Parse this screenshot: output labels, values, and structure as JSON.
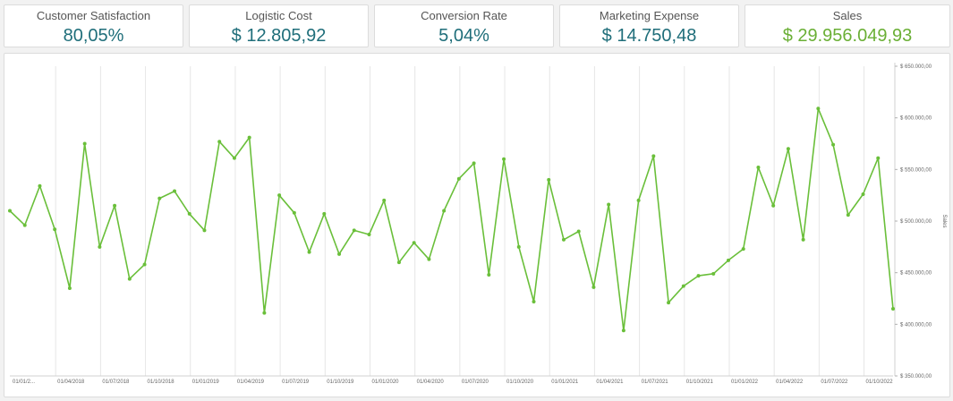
{
  "kpis": [
    {
      "label": "Customer Satisfaction",
      "value": "80,05%"
    },
    {
      "label": "Logistic Cost",
      "value": "$ 12.805,92"
    },
    {
      "label": "Conversion Rate",
      "value": "5,04%"
    },
    {
      "label": "Marketing Expense",
      "value": "$ 14.750,48"
    },
    {
      "label": "Sales",
      "value": "$ 29.956.049,93"
    }
  ],
  "colors": {
    "kpi_value": "#1f6e7a",
    "sales_value": "#6aaf35",
    "line": "#6abf3a",
    "grid": "#e6e6e6"
  },
  "chart_data": {
    "type": "line",
    "title": "",
    "xlabel": "",
    "ylabel": "Sales",
    "ylim": [
      350000,
      650000
    ],
    "y_ticks": [
      350000,
      400000,
      450000,
      500000,
      550000,
      600000,
      650000
    ],
    "y_tick_labels": [
      "$ 350.000,00",
      "$ 400.000,00",
      "$ 450.000,00",
      "$ 500.000,00",
      "$ 550.000,00",
      "$ 600.000,00",
      "$ 650.000,00"
    ],
    "x_tick_labels": [
      "01/01/2...",
      "01/04/2018",
      "01/07/2018",
      "01/10/2018",
      "01/01/2019",
      "01/04/2019",
      "01/07/2019",
      "01/10/2019",
      "01/01/2020",
      "01/04/2020",
      "01/07/2020",
      "01/10/2020",
      "01/01/2021",
      "01/04/2021",
      "01/07/2021",
      "01/10/2021",
      "01/01/2022",
      "01/04/2022",
      "01/07/2022",
      "01/10/2022"
    ],
    "grid": true,
    "series": [
      {
        "name": "Sales",
        "values": [
          510000,
          496000,
          534000,
          492000,
          435000,
          575000,
          475000,
          515000,
          444000,
          458000,
          522000,
          529000,
          507000,
          491000,
          577000,
          561000,
          581000,
          411000,
          525000,
          508000,
          470000,
          507000,
          468000,
          491000,
          487000,
          520000,
          460000,
          479000,
          463000,
          510000,
          541000,
          556000,
          448000,
          560000,
          475000,
          422000,
          540000,
          482000,
          490000,
          436000,
          516000,
          394000,
          520000,
          563000,
          421000,
          437000,
          447000,
          449000,
          462000,
          473000,
          552000,
          515000,
          570000,
          482000,
          609000,
          574000,
          506000,
          526000,
          561000,
          415000
        ]
      }
    ]
  }
}
